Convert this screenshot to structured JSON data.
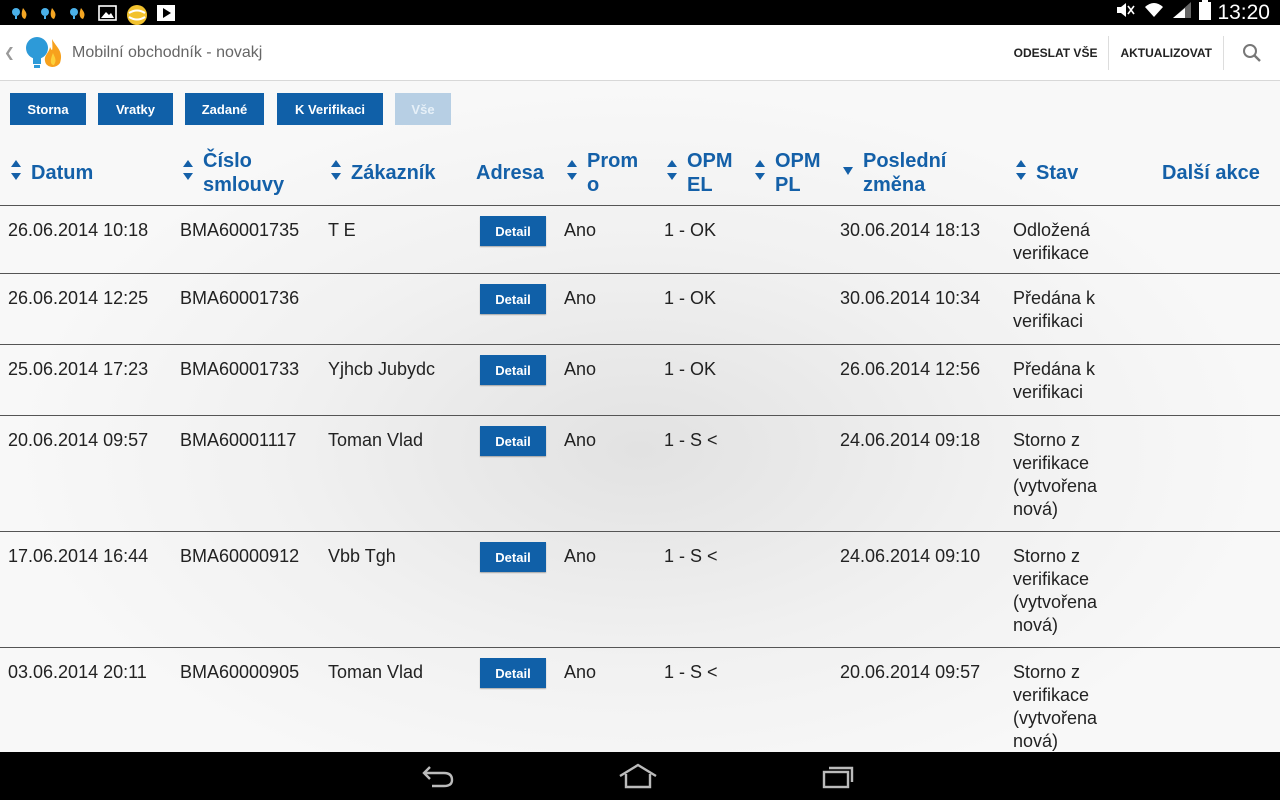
{
  "statusbar": {
    "time": "13:20",
    "left_icons": [
      "app-icon",
      "app-icon",
      "app-icon",
      "gallery-icon",
      "ball-icon",
      "play-store-icon"
    ],
    "right_icons": [
      "mute-icon",
      "wifi-icon",
      "signal-icon",
      "battery-icon"
    ]
  },
  "actionbar": {
    "title": "Mobilní obchodník - novakj",
    "send_all": "ODESLAT VŠE",
    "update": "AKTUALIZOVAT"
  },
  "filters": [
    {
      "label": "Storna",
      "active": false
    },
    {
      "label": "Vratky",
      "active": false
    },
    {
      "label": "Zadané",
      "active": false
    },
    {
      "label": "K Verifikaci",
      "active": false
    },
    {
      "label": "Vše",
      "active": true
    }
  ],
  "columns": {
    "datum": "Datum",
    "cislo_1": "Číslo",
    "cislo_2": "smlouvy",
    "zakaznik": "Zákazník",
    "adresa": "Adresa",
    "promo_1": "Prom",
    "promo_2": "o",
    "opm_el_1": "OPM",
    "opm_el_2": "EL",
    "opm_pl_1": "OPM",
    "opm_pl_2": "PL",
    "posledni_1": "Poslední",
    "posledni_2": "změna",
    "stav": "Stav",
    "dalsi": "Další akce"
  },
  "detail_label": "Detail",
  "rows": [
    {
      "datum": "26.06.2014 10:18",
      "cislo": "BMA60001735",
      "zakaznik": "T E",
      "promo": "Ano",
      "opm_el": "1 - OK",
      "zmena": "30.06.2014 18:13",
      "stav_lines": [
        "Odložená",
        "verifikace"
      ]
    },
    {
      "datum": "26.06.2014 12:25",
      "cislo": "BMA60001736",
      "zakaznik": "",
      "promo": "Ano",
      "opm_el": "1 - OK",
      "zmena": "30.06.2014 10:34",
      "stav_lines": [
        "Předána k",
        "verifikaci"
      ]
    },
    {
      "datum": "25.06.2014 17:23",
      "cislo": "BMA60001733",
      "zakaznik": "Yjhcb Jubydc",
      "promo": "Ano",
      "opm_el": "1 - OK",
      "zmena": "26.06.2014 12:56",
      "stav_lines": [
        "Předána k",
        "verifikaci"
      ]
    },
    {
      "datum": "20.06.2014 09:57",
      "cislo": "BMA60001117",
      "zakaznik": "Toman Vlad",
      "promo": "Ano",
      "opm_el": "1 - S <",
      "zmena": "24.06.2014 09:18",
      "stav_lines": [
        "Storno z",
        "verifikace",
        "(vytvořena",
        "nová)"
      ]
    },
    {
      "datum": "17.06.2014 16:44",
      "cislo": "BMA60000912",
      "zakaznik": "Vbb Tgh",
      "promo": "Ano",
      "opm_el": "1 - S <",
      "zmena": "24.06.2014 09:10",
      "stav_lines": [
        "Storno z",
        "verifikace",
        "(vytvořena",
        "nová)"
      ]
    },
    {
      "datum": "03.06.2014 20:11",
      "cislo": "BMA60000905",
      "zakaznik": "Toman Vlad",
      "promo": "Ano",
      "opm_el": "1 - S <",
      "zmena": "20.06.2014 09:57",
      "stav_lines": [
        "Storno z",
        "verifikace",
        "(vytvořena",
        "nová)"
      ]
    }
  ],
  "navbar": {
    "icons": [
      "back-icon",
      "home-icon",
      "recent-apps-icon"
    ]
  },
  "colors": {
    "accent": "#1060a8",
    "header_text": "#1460a8",
    "inactive_filter": "#b7cfe4"
  }
}
